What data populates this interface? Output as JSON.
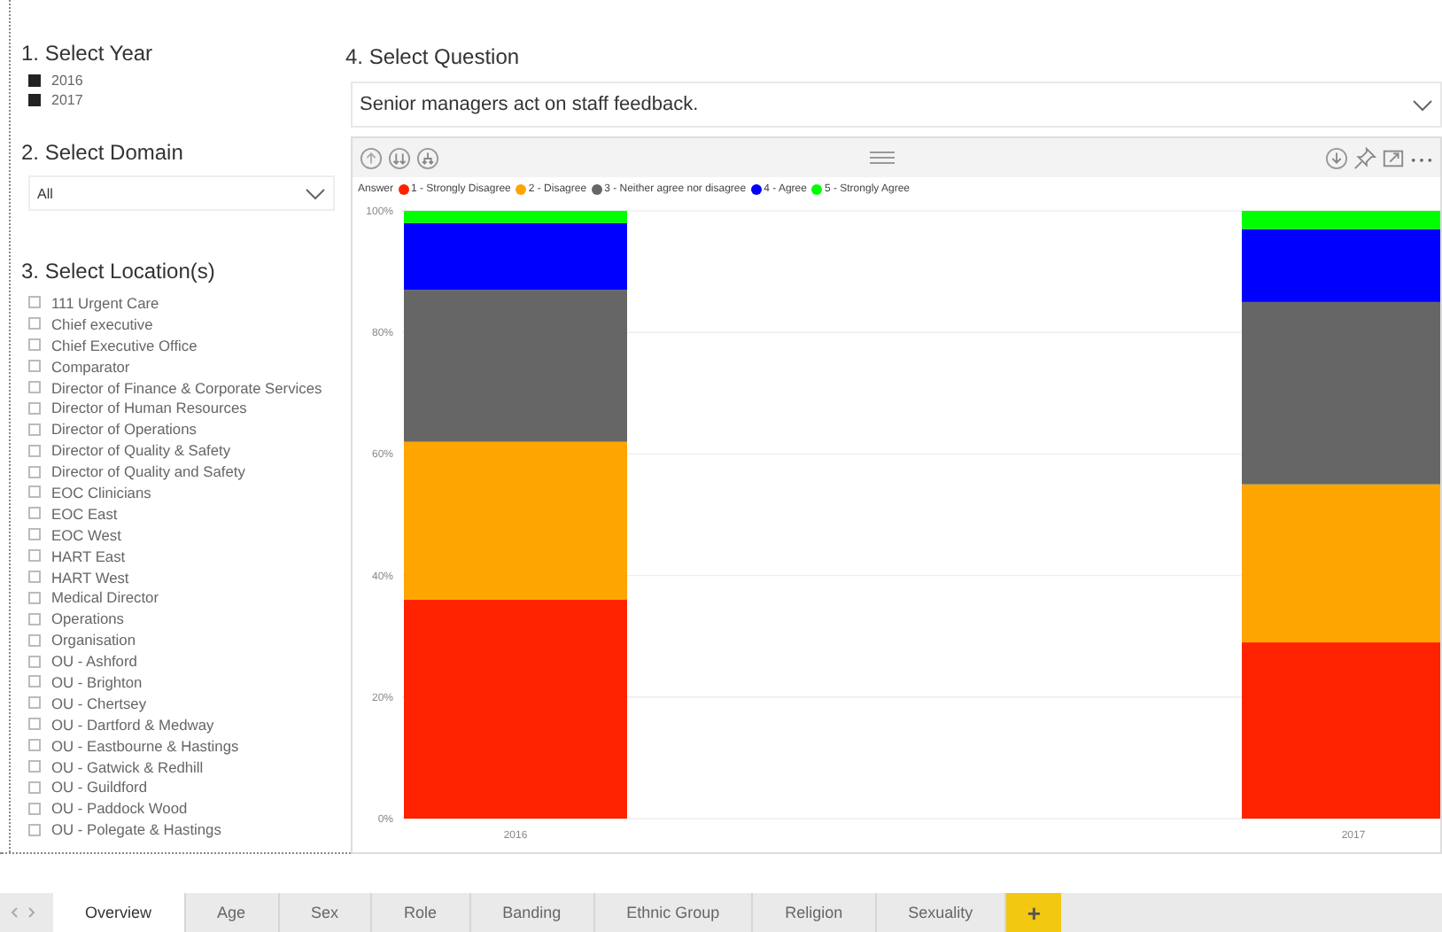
{
  "year_slicer": {
    "title": "1. Select Year",
    "items": [
      {
        "label": "2016",
        "checked": true
      },
      {
        "label": "2017",
        "checked": true
      }
    ]
  },
  "domain_slicer": {
    "title": "2. Select Domain",
    "value": "All"
  },
  "location_slicer": {
    "title": "3. Select Location(s)",
    "items": [
      {
        "label": "111 Urgent Care",
        "checked": false
      },
      {
        "label": "Chief executive",
        "checked": false
      },
      {
        "label": "Chief Executive Office",
        "checked": false
      },
      {
        "label": "Comparator",
        "checked": false
      },
      {
        "label": "Director of Finance & Corporate Services",
        "checked": false
      },
      {
        "label": "Director of Human Resources",
        "checked": false
      },
      {
        "label": "Director of Operations",
        "checked": false
      },
      {
        "label": "Director of Quality & Safety",
        "checked": false
      },
      {
        "label": "Director of Quality and Safety",
        "checked": false
      },
      {
        "label": "EOC Clinicians",
        "checked": false
      },
      {
        "label": "EOC East",
        "checked": false
      },
      {
        "label": "EOC West",
        "checked": false
      },
      {
        "label": "HART East",
        "checked": false
      },
      {
        "label": "HART West",
        "checked": false
      },
      {
        "label": "Medical Director",
        "checked": false
      },
      {
        "label": "Operations",
        "checked": false
      },
      {
        "label": "Organisation",
        "checked": false
      },
      {
        "label": "OU - Ashford",
        "checked": false
      },
      {
        "label": "OU - Brighton",
        "checked": false
      },
      {
        "label": "OU - Chertsey",
        "checked": false
      },
      {
        "label": "OU - Dartford & Medway",
        "checked": false
      },
      {
        "label": "OU - Eastbourne & Hastings",
        "checked": false
      },
      {
        "label": "OU - Gatwick & Redhill",
        "checked": false
      },
      {
        "label": "OU - Guildford",
        "checked": false
      },
      {
        "label": "OU - Paddock Wood",
        "checked": false
      },
      {
        "label": "OU - Polegate & Hastings",
        "checked": false
      }
    ]
  },
  "question_slicer": {
    "title": "4. Select Question",
    "value": "Senior managers act on staff feedback."
  },
  "chart": {
    "legend_title": "Answer",
    "chart_data": {
      "type": "bar",
      "stacked": true,
      "categories": [
        "2016",
        "2017"
      ],
      "series": [
        {
          "name": "1 - Strongly Disagree",
          "color": "#ff2200",
          "values": [
            36,
            29
          ]
        },
        {
          "name": "2 - Disagree",
          "color": "#ffa500",
          "values": [
            26,
            26
          ]
        },
        {
          "name": "3 - Neither agree nor disagree",
          "color": "#666666",
          "values": [
            25,
            30
          ]
        },
        {
          "name": "4 - Agree",
          "color": "#0000ff",
          "values": [
            11,
            12
          ]
        },
        {
          "name": "5 - Strongly Agree",
          "color": "#00ff00",
          "values": [
            2,
            3
          ]
        }
      ],
      "ylim": [
        0,
        100
      ],
      "grid": true,
      "yticks": [
        {
          "value": 0,
          "label": "0%"
        },
        {
          "value": 20,
          "label": "20%"
        },
        {
          "value": 40,
          "label": "40%"
        },
        {
          "value": 60,
          "label": "60%"
        },
        {
          "value": 80,
          "label": "80%"
        },
        {
          "value": 100,
          "label": "100%"
        }
      ]
    }
  },
  "page_tabs": [
    {
      "label": "Overview",
      "selected": true
    },
    {
      "label": "Age",
      "selected": false
    },
    {
      "label": "Sex",
      "selected": false
    },
    {
      "label": "Role",
      "selected": false
    },
    {
      "label": "Banding",
      "selected": false
    },
    {
      "label": "Ethnic Group",
      "selected": false
    },
    {
      "label": "Religion",
      "selected": false
    },
    {
      "label": "Sexuality",
      "selected": false
    }
  ],
  "add_page_button": "+"
}
